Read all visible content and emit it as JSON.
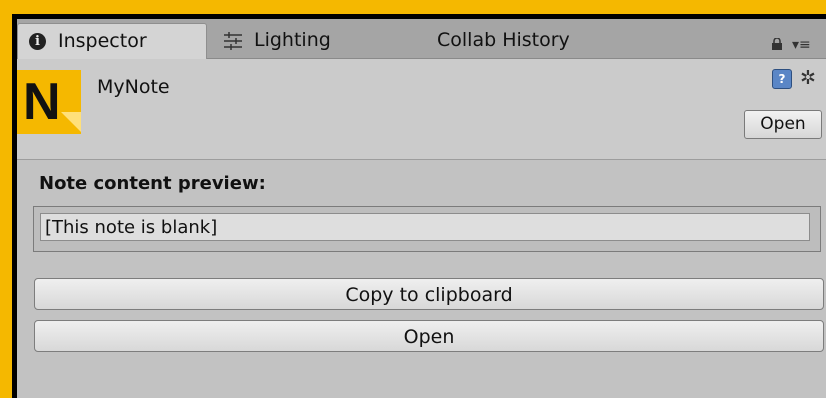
{
  "tabs": [
    {
      "label": "Inspector",
      "icon": "info-icon",
      "active": true
    },
    {
      "label": "Lighting",
      "icon": "lighting-icon",
      "active": false
    },
    {
      "label": "Collab History",
      "active": false
    }
  ],
  "header": {
    "title": "MyNote",
    "logo_letter": "N",
    "open_label": "Open",
    "help_icon_glyph": "?",
    "gear_icon_glyph": "✲",
    "menu_icon_glyph": "▾≡"
  },
  "body": {
    "preview_label": "Note content preview:",
    "preview_value": "[This note is blank]",
    "copy_button": "Copy to clipboard",
    "open_button": "Open"
  },
  "colors": {
    "accent": "#f5b800",
    "panel": "#c2c2c2"
  }
}
